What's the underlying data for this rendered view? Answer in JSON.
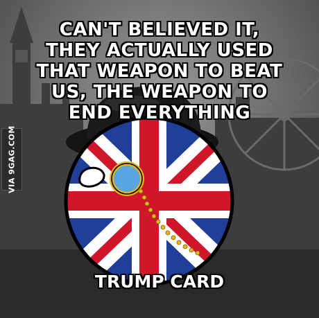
{
  "caption_top": {
    "line1": "CAN'T BELIEVED IT,",
    "line2": "THEY ACTUALLY USED",
    "line3": "THAT WEAPON TO BEAT",
    "line4": "US, THE WEAPON TO",
    "line5": "END EVERYTHING"
  },
  "caption_bottom": "TRUMP CARD",
  "watermark": "VIA 9GAG.COM",
  "colors": {
    "flag_blue": "#1f3f98",
    "flag_red": "#d0172a",
    "hat": "#141414",
    "monocle": "#e4b619"
  }
}
